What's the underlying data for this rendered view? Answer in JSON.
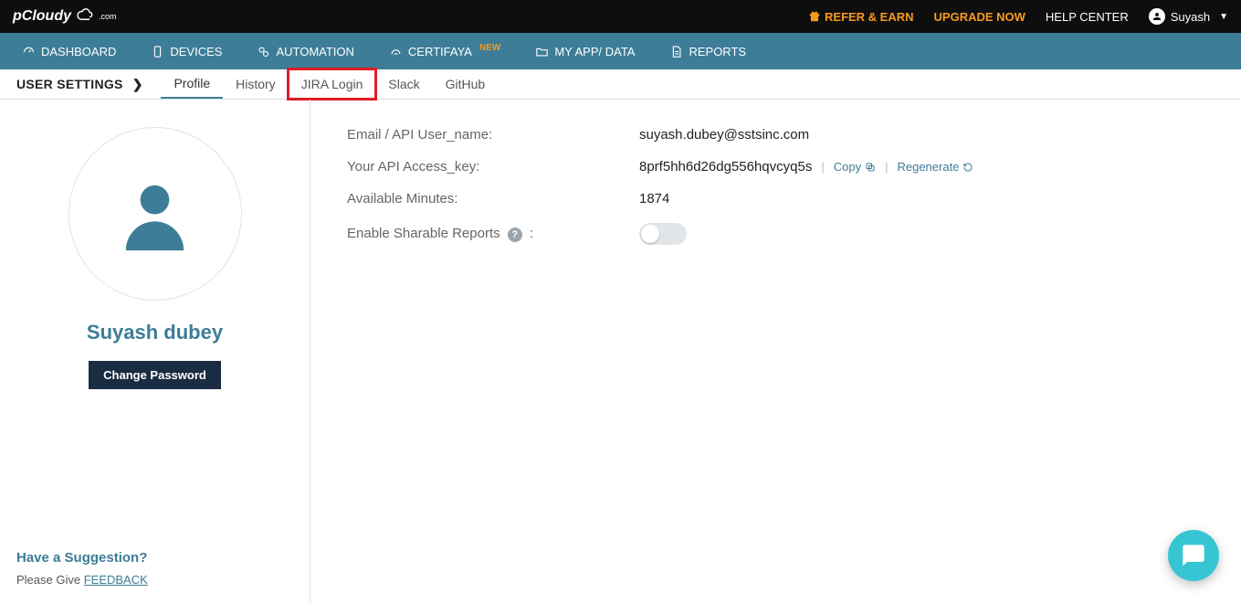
{
  "topbar": {
    "brand": "pCloudy",
    "brand_suffix": ".com",
    "refer_earn": "REFER & EARN",
    "upgrade": "UPGRADE NOW",
    "help_center": "HELP CENTER",
    "user_name": "Suyash"
  },
  "nav": {
    "dashboard": "DASHBOARD",
    "devices": "DEVICES",
    "automation": "AUTOMATION",
    "certifaya": "CERTIFAYA",
    "new_badge": "NEW",
    "myapp": "MY APP/ DATA",
    "reports": "REPORTS"
  },
  "tabs": {
    "heading": "USER SETTINGS",
    "profile": "Profile",
    "history": "History",
    "jira": "JIRA Login",
    "slack": "Slack",
    "github": "GitHub"
  },
  "profile": {
    "user_display_name": "Suyash dubey",
    "change_password": "Change Password",
    "labels": {
      "email": "Email / API User_name:",
      "api_key": "Your API Access_key:",
      "minutes": "Available Minutes:",
      "sharable": "Enable Sharable Reports",
      "sharable_colon": " :"
    },
    "values": {
      "email": "suyash.dubey@sstsinc.com",
      "api_key": "8prf5hh6d26dg556hqvcyq5s",
      "minutes": "1874"
    },
    "actions": {
      "copy": "Copy",
      "regenerate": "Regenerate"
    }
  },
  "suggestion": {
    "question": "Have a Suggestion?",
    "prefix": "Please Give ",
    "link": "FEEDBACK"
  }
}
